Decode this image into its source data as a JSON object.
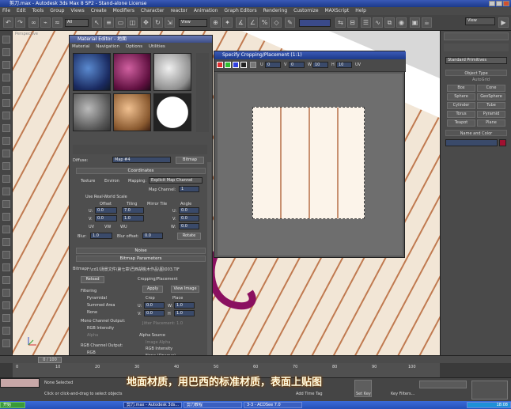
{
  "window": {
    "title": "剪刀.max - Autodesk 3ds Max 8 SP2 - Stand-alone License"
  },
  "menu": [
    "File",
    "Edit",
    "Tools",
    "Group",
    "Views",
    "Create",
    "Modifiers",
    "Character",
    "reactor",
    "Animation",
    "Graph Editors",
    "Rendering",
    "Customize",
    "MAXScript",
    "Help"
  ],
  "toolbar": {
    "selection_filter": "All",
    "ref_coord": "View",
    "named_set": "View"
  },
  "viewport": {
    "label": "Perspective"
  },
  "material_editor": {
    "title": "Material Editor - 地面",
    "menu": [
      "Material",
      "Navigation",
      "Options",
      "Utilities"
    ],
    "diffuse_label": "Diffuse:",
    "map_name": "Map #4",
    "map_type": "Bitmap",
    "coordinates": {
      "header": "Coordinates",
      "texture": "Texture",
      "environ": "Environ",
      "mapping_label": "Mapping:",
      "mapping_value": "Explicit Map Channel",
      "map_channel_label": "Map Channel:",
      "map_channel_value": "1",
      "real_world": "Use Real-World Scale",
      "offset": "Offset",
      "tiling": "Tiling",
      "mirror_tile": "Mirror Tile",
      "angle": "Angle",
      "u": "U:",
      "v": "V:",
      "w": "W:",
      "u_offset": "0.0",
      "v_offset": "0.0",
      "u_tiling": "7.0",
      "v_tiling": "1.0",
      "u_angle": "0.0",
      "v_angle": "0.0",
      "w_angle": "0.0",
      "uv": "UV",
      "vw": "VW",
      "wu": "WU",
      "blur_label": "Blur:",
      "blur_value": "1.0",
      "blur_offset_label": "Blur offset:",
      "blur_offset_value": "0.0",
      "rotate": "Rotate"
    },
    "noise_header": "Noise",
    "bitmap_params": {
      "header": "Bitmap Parameters",
      "path_label": "Bitmap:",
      "path": "F:\\cd1\\场景文件\\第七章\\巴西胡桃木作品\\图\\003.TIF",
      "reload": "Reload",
      "cropping": "Cropping/Placement",
      "apply": "Apply",
      "view_image": "View Image",
      "crop": "Crop",
      "place": "Place",
      "u_val": "0.0",
      "v_val": "0.0",
      "w_val": "1.0",
      "h_val": "1.0",
      "jitter": "Jitter Placement: 1.0",
      "filtering": "Filtering",
      "pyramidal": "Pyramidal",
      "summed": "Summed Area",
      "none": "None",
      "mono_output": "Mono Channel Output:",
      "rgb_intensity": "RGB Intensity",
      "alpha": "Alpha",
      "rgb_output": "RGB Channel Output:",
      "rgb": "RGB",
      "alpha_source": "Alpha Source",
      "image_alpha": "Image Alpha",
      "alpha_rgb_intensity": "RGB Intensity",
      "none_opaque": "None (Opaque)"
    }
  },
  "crop_dialog": {
    "title": "Specify Cropping/Placement (1:1)",
    "u_label": "U",
    "u_value": "0",
    "v_label": "V",
    "v_value": "0",
    "w_label": "W",
    "w_value": "10",
    "h_label": "H",
    "h_value": "10",
    "uv_label": "UV"
  },
  "command_panel": {
    "dropdown": "Standard Primitives",
    "object_type": "Object Type",
    "autogrid": "AutoGrid",
    "objects": [
      "Box",
      "Cone",
      "Sphere",
      "GeoSphere",
      "Cylinder",
      "Tube",
      "Torus",
      "Pyramid",
      "Teapot",
      "Plane"
    ],
    "name_color": "Name and Color",
    "swatch_color": "#a01030"
  },
  "timeline": {
    "frame": "0 / 100",
    "ticks": [
      "0",
      "10",
      "20",
      "30",
      "40",
      "50",
      "60",
      "70",
      "80",
      "90",
      "100"
    ]
  },
  "status": {
    "selection": "None Selected",
    "prompt": "Click or click-and-drag to select objects",
    "add_time_tag": "Add Time Tag",
    "set_key": "Set Key",
    "key_filters": "Key Filters..."
  },
  "caption": "地面材质，用巴西的标准材质，表面上贴图",
  "taskbar": {
    "start": "开始",
    "tasks": [
      "剪刀.max - Autodesk 3ds...",
      "剪刀教程",
      "3-3 - ACDSee 7.0"
    ],
    "clock": "18:08"
  },
  "colors": {
    "accent": "#e68a1e",
    "maroon": "#8a1040"
  }
}
